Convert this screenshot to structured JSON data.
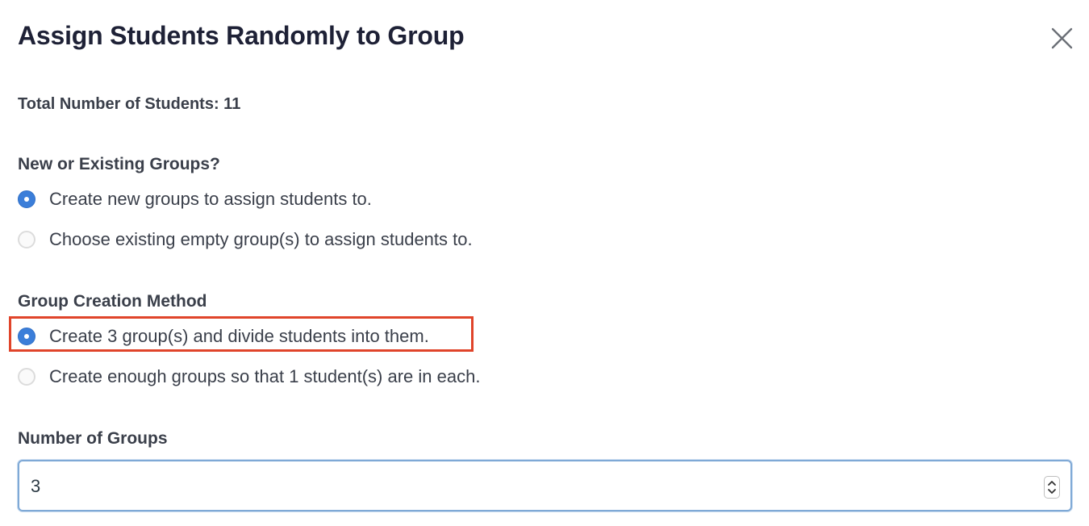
{
  "dialog": {
    "title": "Assign Students Randomly to Group",
    "close_icon": "close-icon"
  },
  "summary": {
    "total_students": "Total Number of Students: 11"
  },
  "group_source": {
    "label": "New or Existing Groups?",
    "options": [
      {
        "label": "Create new groups to assign students to.",
        "selected": true
      },
      {
        "label": "Choose existing empty group(s) to assign students to.",
        "selected": false
      }
    ]
  },
  "creation_method": {
    "label": "Group Creation Method",
    "options": [
      {
        "label": "Create 3 group(s) and divide students into them.",
        "selected": true
      },
      {
        "label": "Create enough groups so that 1 student(s) are in each.",
        "selected": false
      }
    ],
    "highlight_color": "#e0442a"
  },
  "number_of_groups": {
    "label": "Number of Groups",
    "value": "3",
    "stepper_icon": "up-down-stepper-icon"
  },
  "colors": {
    "accent": "#3b7ed9",
    "title": "#1e2136",
    "text": "#3a3f4a",
    "focus_border": "#7fa9d6"
  }
}
